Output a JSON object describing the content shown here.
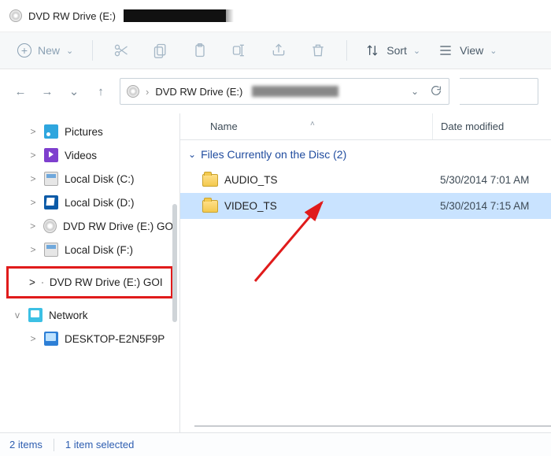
{
  "window": {
    "title_prefix": "DVD RW Drive (E:)"
  },
  "toolbar": {
    "new_label": "New",
    "sort_label": "Sort",
    "view_label": "View"
  },
  "nav": {
    "address_prefix": "DVD RW Drive (E:)"
  },
  "columns": {
    "name": "Name",
    "date": "Date modified"
  },
  "group": {
    "label": "Files Currently on the Disc (2)"
  },
  "rows": [
    {
      "name": "AUDIO_TS",
      "date": "5/30/2014 7:01 AM",
      "selected": false
    },
    {
      "name": "VIDEO_TS",
      "date": "5/30/2014 7:15 AM",
      "selected": true
    }
  ],
  "sidebar": {
    "items": [
      {
        "label": "Pictures",
        "icon": "pictures",
        "expand": ">",
        "sub": true
      },
      {
        "label": "Videos",
        "icon": "videos",
        "expand": ">",
        "sub": true
      },
      {
        "label": "Local Disk (C:)",
        "icon": "hdd",
        "expand": ">",
        "sub": true
      },
      {
        "label": "Local Disk (D:)",
        "icon": "hdd2",
        "expand": ">",
        "sub": true
      },
      {
        "label": "DVD RW Drive (E:) GO",
        "icon": "disc",
        "expand": ">",
        "sub": true
      },
      {
        "label": "Local Disk (F:)",
        "icon": "hdd",
        "expand": ">",
        "sub": true
      }
    ],
    "highlighted": {
      "label": "DVD RW Drive (E:) GOI",
      "icon": "disc",
      "expand": ">"
    },
    "network": {
      "label": "Network",
      "expand": "v"
    },
    "network_children": [
      {
        "label": "DESKTOP-E2N5F9P",
        "icon": "pc",
        "expand": ">"
      }
    ]
  },
  "status": {
    "items_text": "2 items",
    "selection_text": "1 item selected"
  }
}
